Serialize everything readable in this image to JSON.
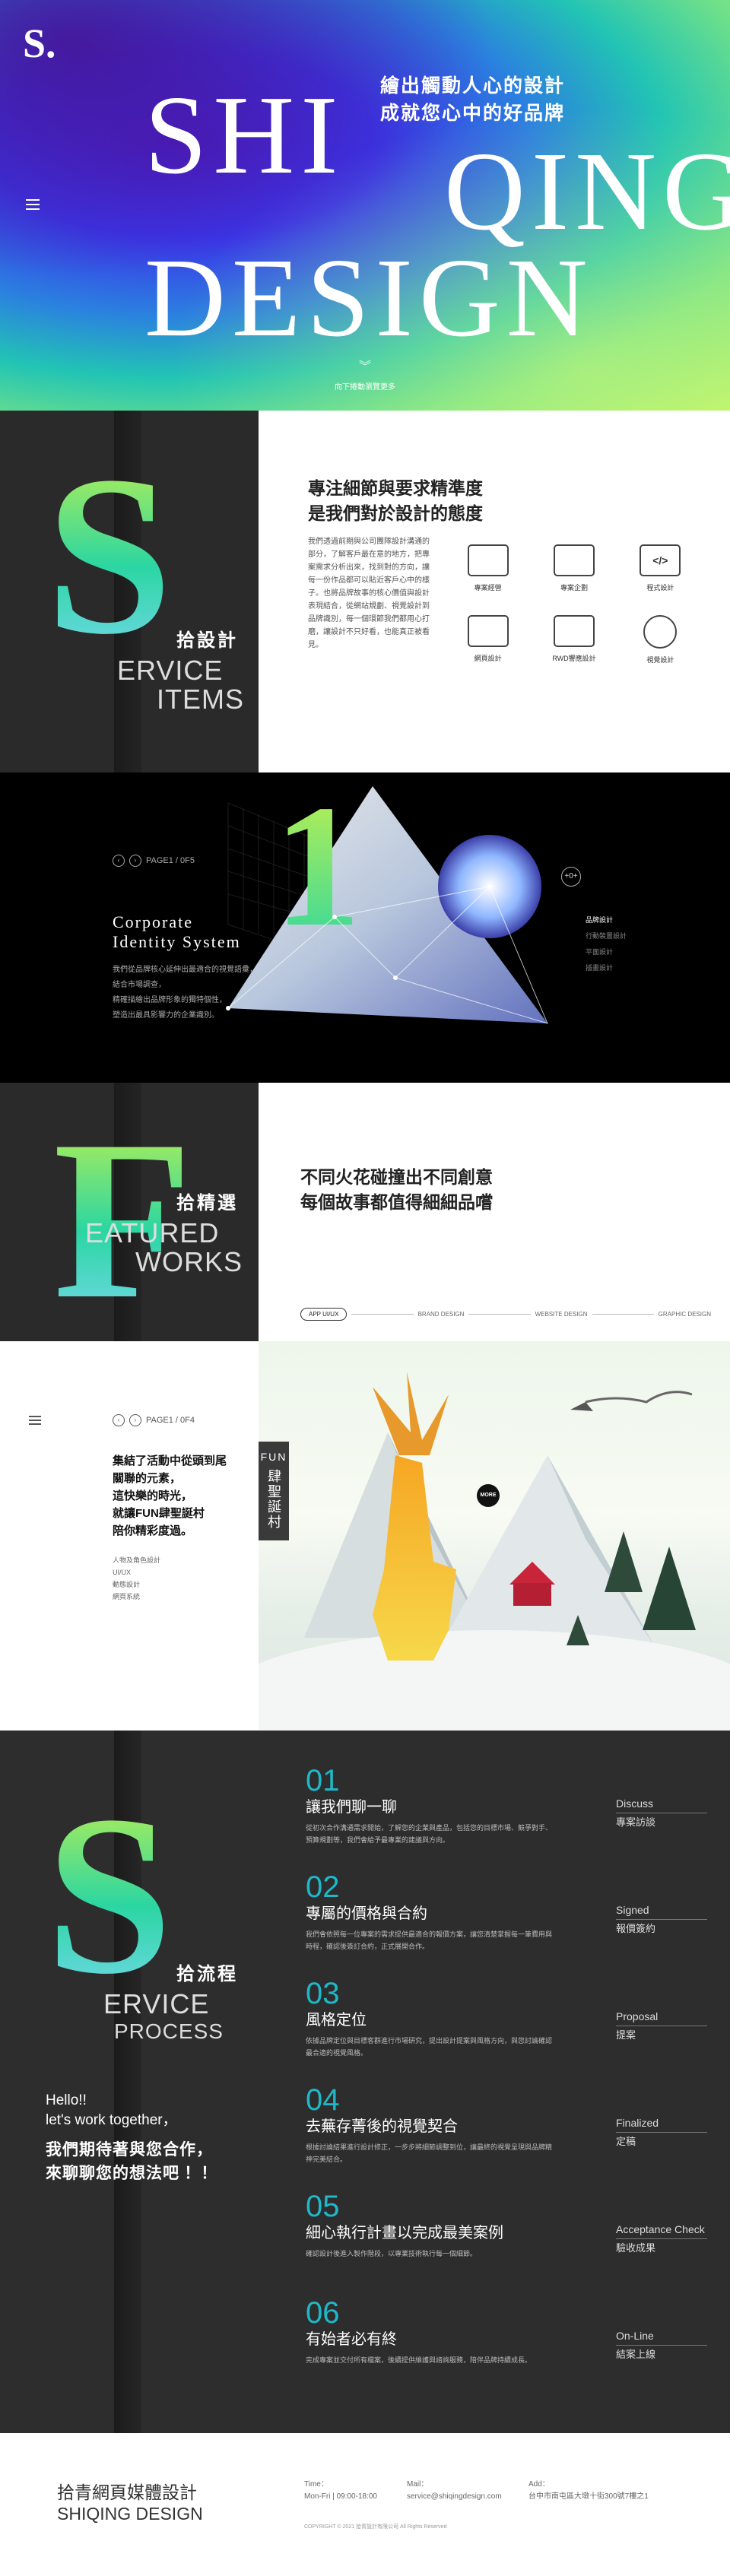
{
  "hero": {
    "logo": "S.",
    "tagline": [
      "繪出觸動人心的設計",
      "成就您心中的好品牌"
    ],
    "words": [
      "SHI",
      "QING",
      "DESIGN"
    ],
    "scroll_label": "向下捲動瀏覽更多"
  },
  "service": {
    "giant_letter": "S",
    "title": "拾設計",
    "sub_lines": [
      "ERVICE",
      "ITEMS"
    ],
    "heading": [
      "專注細節與要求精準度",
      "是我們對於設計的態度"
    ],
    "paragraph": "我們透過前期與公司團隊設計溝通的部分，了解客戶最在意的地方，把專案需求分析出來，找到對的方向，讓每一份作品都可以貼近客戶心中的樣子。也將品牌故事的核心價值與設計表現結合，從網站規劃、視覺設計到品牌識別，每一個環節我們都用心打磨，讓設計不只好看，也能真正被看見。",
    "items": [
      {
        "label": "專案經營",
        "icon": "presentation-icon"
      },
      {
        "label": "專案企劃",
        "icon": "chart-icon"
      },
      {
        "label": "程式設計",
        "icon": "code-icon"
      },
      {
        "label": "網頁設計",
        "icon": "desktop-icon"
      },
      {
        "label": "RWD響應設計",
        "icon": "responsive-icon"
      },
      {
        "label": "視覺設計",
        "icon": "brush-icon"
      }
    ]
  },
  "corporate": {
    "page": "PAGE1 / 0F5",
    "title": [
      "Corporate",
      "Identity System"
    ],
    "desc": [
      "我們從品牌核心延伸出最適合的視覺語彙，",
      "結合市場調查，",
      "精確描繪出品牌形象的獨特個性，",
      "塑造出最具影響力的企業識別。"
    ],
    "menu": [
      "品牌設計",
      "行動裝置設計",
      "平面設計",
      "插畫設計"
    ],
    "big_number": "1",
    "next_label": "+0+"
  },
  "featured": {
    "giant_letter": "F",
    "title": "拾精選",
    "sub_lines": [
      "EATURED",
      "WORKS"
    ],
    "heading": [
      "不同火花碰撞出不同創意",
      "每個故事都值得細細品嚐"
    ],
    "tabs": [
      "APP UI/UX",
      "BRAND DESIGN",
      "WEBSITE DESIGN",
      "GRAPHIC DESIGN"
    ]
  },
  "fun": {
    "page": "PAGE1 / 0F4",
    "title": [
      "集結了活動中從頭到尾",
      "關聯的元素，",
      "這快樂的時光，",
      "就讓FUN肆聖誕村",
      "陪你精彩度過。"
    ],
    "tags": [
      "人物及角色設計",
      "UI/UX",
      "動態設計",
      "網頁系統"
    ],
    "label_en": "FUN",
    "label_zh": "肆聖誕村",
    "more": "MORE"
  },
  "process": {
    "giant_letter": "S",
    "title": "拾流程",
    "sub_lines": [
      "ERVICE",
      "PROCESS"
    ],
    "hello": [
      "Hello!!",
      "let's work together，"
    ],
    "call": [
      "我們期待著與您合作，",
      "來聊聊您的想法吧 ！！"
    ],
    "steps": [
      {
        "num": "01",
        "title": "讓我們聊一聊",
        "desc": "從初次合作溝通需求開始，了解您的企業與產品，包括您的目標市場、競爭對手、預算規劃等，我們會給予最專業的建議與方向。"
      },
      {
        "num": "02",
        "title": "專屬的價格與合約",
        "desc": "我們會依照每一位專案的需求提供最適合的報價方案，讓您清楚掌握每一筆費用與時程，確認後簽訂合約，正式展開合作。"
      },
      {
        "num": "03",
        "title": "風格定位",
        "desc": "依據品牌定位與目標客群進行市場研究，提出設計提案與風格方向，與您討論確認最合適的視覺風格。"
      },
      {
        "num": "04",
        "title": "去蕪存菁後的視覺契合",
        "desc": "根據討論結果進行設計修正，一步步將細節調整到位，讓最終的視覺呈現與品牌精神完美結合。"
      },
      {
        "num": "05",
        "title": "細心執行計畫以完成最美案例",
        "desc": "確認設計後進入製作階段，以專業技術執行每一個細節。"
      },
      {
        "num": "06",
        "title": "有始者必有終",
        "desc": "完成專案並交付所有檔案，後續提供維護與諮詢服務，陪伴品牌持續成長。"
      }
    ],
    "side": [
      {
        "en": "Discuss",
        "zh": "專案訪談"
      },
      {
        "en": "Signed",
        "zh": "報價簽約"
      },
      {
        "en": "Proposal",
        "zh": "提案"
      },
      {
        "en": "Finalized",
        "zh": "定稿"
      },
      {
        "en": "Acceptance Check",
        "zh": "驗收成果"
      },
      {
        "en": "On-Line",
        "zh": "結案上線"
      }
    ]
  },
  "footer": {
    "name_zh": "拾青網頁媒體設計",
    "name_en": "SHIQING DESIGN",
    "time_label": "Time：",
    "time_value": "Mon-Fri | 09:00-18:00",
    "mail_label": "Mail：",
    "mail_value": "service@shiqingdesign.com",
    "addr_label": "Add：",
    "addr_value": "台中市南屯區大墩十街300號7樓之1",
    "copyright": "COPYRIGHT © 2021 拾青設計有限公司 All Rights Reserved"
  },
  "colors": {
    "accent": "#1fb8c9",
    "dark": "#2d2d2d",
    "lime": "#c9f24a"
  }
}
